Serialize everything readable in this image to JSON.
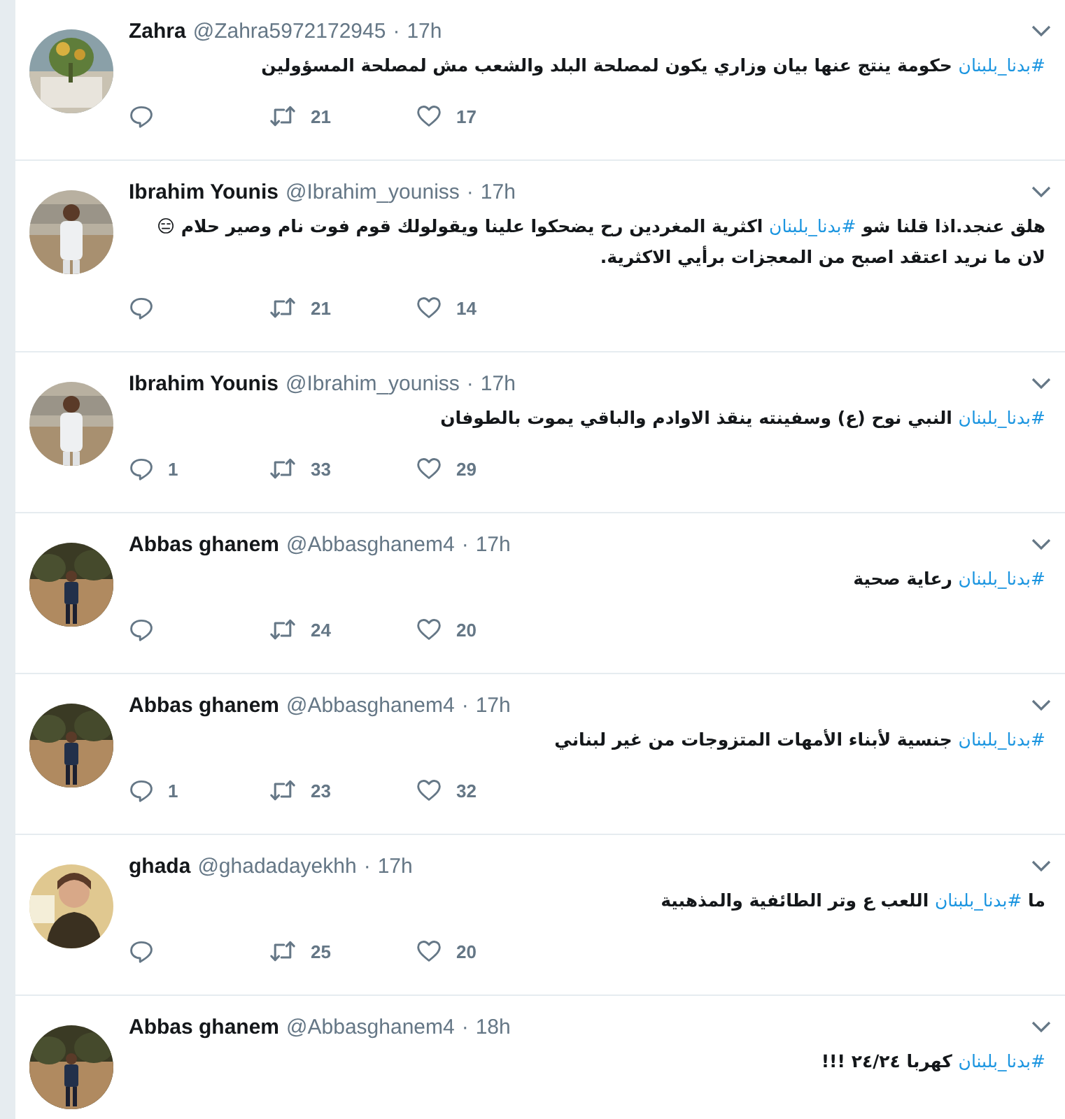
{
  "tweets": [
    {
      "name": "Zahra",
      "handle": "@Zahra5972172945",
      "separator": "·",
      "time": "17h",
      "avatar": {
        "kind": "picture"
      },
      "text": [
        {
          "kind": "hashtag",
          "text": "#بدنا_بلبنان"
        },
        {
          "kind": "plain",
          "text": "  حكومة ينتج عنها بيان وزاري يكون لمصلحة البلد والشعب مش لمصلحة المسؤولين"
        }
      ],
      "retweets": "21",
      "likes": "17"
    },
    {
      "name": "Ibrahim Younis",
      "handle": "@Ibrahim_youniss",
      "separator": "·",
      "time": "17h",
      "avatar": {
        "kind": "picture"
      },
      "text": [
        {
          "kind": "plain",
          "text": "هلق عنجد.اذا قلنا شو "
        },
        {
          "kind": "hashtag",
          "text": "#بدنا_بلبنان"
        },
        {
          "kind": "plain",
          "text": " اكثرية المغردين رح يضحكوا علينا ويقولولك قوم فوت نام وصير حلام 😑\nلان ما نريد اعتقد اصبح من المعجزات برأيي الاكثرية."
        }
      ],
      "retweets": "21",
      "likes": "14"
    },
    {
      "name": "Ibrahim Younis",
      "handle": "@Ibrahim_youniss",
      "separator": "·",
      "time": "17h",
      "avatar": {
        "kind": "picture"
      },
      "text": [
        {
          "kind": "hashtag",
          "text": "#بدنا_بلبنان"
        },
        {
          "kind": "plain",
          "text": " النبي نوح (ع)  وسفينته ينقذ  الاوادم والباقي يموت بالطوفان"
        }
      ],
      "replies": "1",
      "retweets": "33",
      "likes": "29"
    },
    {
      "name": "Abbas ghanem",
      "handle": "@Abbasghanem4",
      "separator": "·",
      "time": "17h",
      "avatar": {
        "kind": "picture"
      },
      "text": [
        {
          "kind": "hashtag",
          "text": "#بدنا_بلبنان"
        },
        {
          "kind": "plain",
          "text": " رعاية صحية"
        }
      ],
      "retweets": "24",
      "likes": "20"
    },
    {
      "name": "Abbas ghanem",
      "handle": "@Abbasghanem4",
      "separator": "·",
      "time": "17h",
      "avatar": {
        "kind": "picture"
      },
      "text": [
        {
          "kind": "hashtag",
          "text": "#بدنا_بلبنان"
        },
        {
          "kind": "plain",
          "text": " جنسية لأبناء الأمهات المتزوجات من غير لبناني"
        }
      ],
      "replies": "1",
      "retweets": "23",
      "likes": "32"
    },
    {
      "name": "ghada",
      "handle": "@ghadadayekhh",
      "separator": "·",
      "time": "17h",
      "avatar": {
        "kind": "picture"
      },
      "text": [
        {
          "kind": "plain",
          "text": "ما "
        },
        {
          "kind": "hashtag",
          "text": "#بدنا_بلبنان"
        },
        {
          "kind": "plain",
          "text": " اللعب ع وتر الطائفية والمذهبية"
        }
      ],
      "retweets": "25",
      "likes": "20"
    },
    {
      "name": "Abbas ghanem",
      "handle": "@Abbasghanem4",
      "separator": "·",
      "time": "18h",
      "avatar": {
        "kind": "picture"
      },
      "text": [
        {
          "kind": "hashtag",
          "text": "#بدنا_بلبنان"
        },
        {
          "kind": "plain",
          "text": " كهربا ٢٤/٢٤ !!!"
        }
      ]
    }
  ]
}
